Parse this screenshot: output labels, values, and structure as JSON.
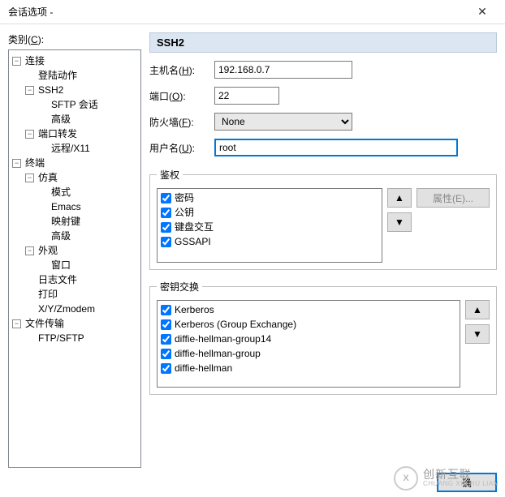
{
  "window": {
    "title": "会话选项 -",
    "close_glyph": "✕"
  },
  "category": {
    "label": "类别",
    "accel": "C",
    "colon": ":"
  },
  "tree": {
    "n0": {
      "label": "连接",
      "toggle": "−"
    },
    "n0_0": {
      "label": "登陆动作"
    },
    "n0_1": {
      "label": "SSH2",
      "toggle": "−"
    },
    "n0_1_0": {
      "label": "SFTP 会话"
    },
    "n0_1_1": {
      "label": "高级"
    },
    "n0_2": {
      "label": "端口转发",
      "toggle": "−"
    },
    "n0_2_0": {
      "label": "远程/X11"
    },
    "n1": {
      "label": "终端",
      "toggle": "−"
    },
    "n1_0": {
      "label": "仿真",
      "toggle": "−"
    },
    "n1_0_0": {
      "label": "模式"
    },
    "n1_0_1": {
      "label": "Emacs"
    },
    "n1_0_2": {
      "label": "映射键"
    },
    "n1_0_3": {
      "label": "高级"
    },
    "n1_1": {
      "label": "外观",
      "toggle": "−"
    },
    "n1_1_0": {
      "label": "窗口"
    },
    "n1_2": {
      "label": "日志文件"
    },
    "n1_3": {
      "label": "打印"
    },
    "n1_4": {
      "label": "X/Y/Zmodem"
    },
    "n2": {
      "label": "文件传输",
      "toggle": "−"
    },
    "n2_0": {
      "label": "FTP/SFTP"
    }
  },
  "pane": {
    "header": "SSH2",
    "host_label": "主机名",
    "host_key": "H",
    "host_value": "192.168.0.7",
    "port_label": "端口",
    "port_key": "O",
    "port_value": "22",
    "firewall_label": "防火墙",
    "firewall_key": "F",
    "firewall_value": "None",
    "user_label": "用户名",
    "user_key": "U",
    "user_value": "root"
  },
  "auth": {
    "legend": "鉴权",
    "items": [
      "密码",
      "公钥",
      "键盘交互",
      "GSSAPI"
    ],
    "props_label": "属性(E)..."
  },
  "kex": {
    "legend": "密钥交换",
    "items": [
      "Kerberos",
      "Kerberos (Group Exchange)",
      "diffie-hellman-group14",
      "diffie-hellman-group",
      "diffie-hellman"
    ]
  },
  "buttons": {
    "ok": "确",
    "up": "▲",
    "down": "▼"
  },
  "watermark": {
    "logo": "X",
    "cn": "创新互联",
    "py": "CHUANG XIN HU LIAN"
  }
}
